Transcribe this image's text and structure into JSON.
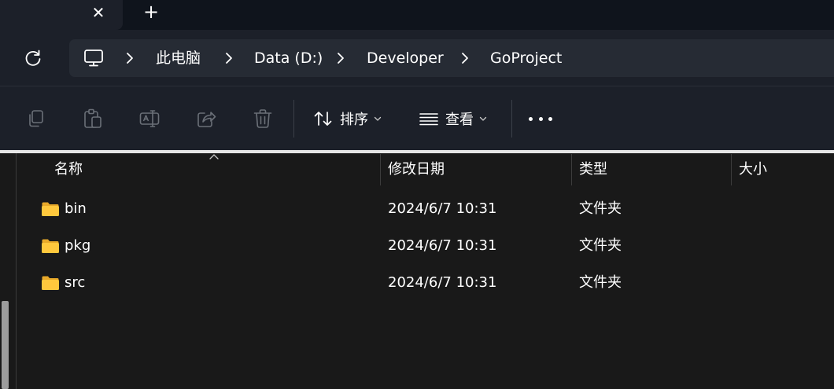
{
  "tabs": {
    "close_glyph": "✕",
    "new_glyph": "+"
  },
  "breadcrumb": {
    "items": [
      "此电脑",
      "Data (D:)",
      "Developer",
      "GoProject"
    ]
  },
  "toolbar": {
    "sort_label": "排序",
    "view_label": "查看",
    "more_icon": "more-dots-icon"
  },
  "columns": {
    "name": "名称",
    "modified": "修改日期",
    "type": "类型",
    "size": "大小"
  },
  "rows": [
    {
      "name": "bin",
      "modified": "2024/6/7 10:31",
      "type": "文件夹",
      "size": ""
    },
    {
      "name": "pkg",
      "modified": "2024/6/7 10:31",
      "type": "文件夹",
      "size": ""
    },
    {
      "name": "src",
      "modified": "2024/6/7 10:31",
      "type": "文件夹",
      "size": ""
    }
  ],
  "colors": {
    "accent": "#ffc83d",
    "background": "#191919",
    "chrome": "#1c2029"
  }
}
